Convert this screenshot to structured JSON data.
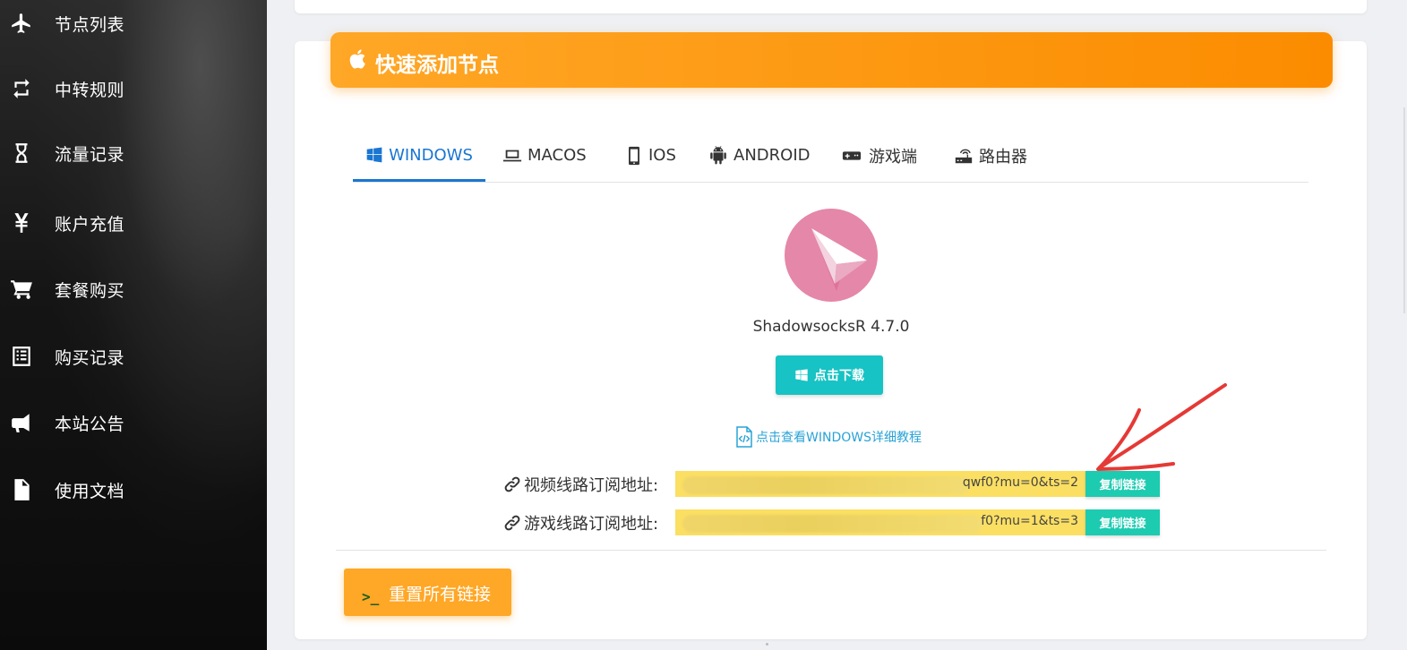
{
  "sidebar": {
    "items": [
      {
        "label": "节点列表",
        "icon": "plane-icon"
      },
      {
        "label": "中转规则",
        "icon": "retweet-icon"
      },
      {
        "label": "流量记录",
        "icon": "hourglass-icon"
      },
      {
        "label": "账户充值",
        "icon": "yen-icon"
      },
      {
        "label": "套餐购买",
        "icon": "cart-icon"
      },
      {
        "label": "购买记录",
        "icon": "list-icon"
      },
      {
        "label": "本站公告",
        "icon": "bullhorn-icon"
      },
      {
        "label": "使用文档",
        "icon": "file-icon"
      }
    ]
  },
  "header": {
    "title": "快速添加节点",
    "icon": "apple-icon",
    "color": "#fb8c00"
  },
  "tabs": [
    {
      "label": "WINDOWS",
      "icon": "windows-icon",
      "active": true
    },
    {
      "label": "MACOS",
      "icon": "laptop-icon",
      "active": false
    },
    {
      "label": "IOS",
      "icon": "phone-icon",
      "active": false
    },
    {
      "label": "ANDROID",
      "icon": "android-icon",
      "active": false
    },
    {
      "label": "游戏端",
      "icon": "gamepad-icon",
      "active": false
    },
    {
      "label": "路由器",
      "icon": "router-icon",
      "active": false
    }
  ],
  "app": {
    "name": "ShadowsocksR 4.7.0",
    "download_label": "点击下载",
    "tutorial_label": "点击查看WINDOWS详细教程"
  },
  "subscriptions": [
    {
      "label": "视频线路订阅地址:",
      "value_tail": "qwf0?mu=0&ts=2",
      "copy_label": "复制链接"
    },
    {
      "label": "游戏线路订阅地址:",
      "value_tail": "f0?mu=1&ts=3",
      "copy_label": "复制链接"
    }
  ],
  "reset": {
    "prompt": ">_",
    "label": "重置所有链接"
  },
  "colors": {
    "accent_blue": "#1976d2",
    "download": "#17c3c4",
    "copy": "#1ccbb0",
    "field": "#fbdf63",
    "reset": "#ffa726",
    "annotation_arrow": "#e53935"
  }
}
